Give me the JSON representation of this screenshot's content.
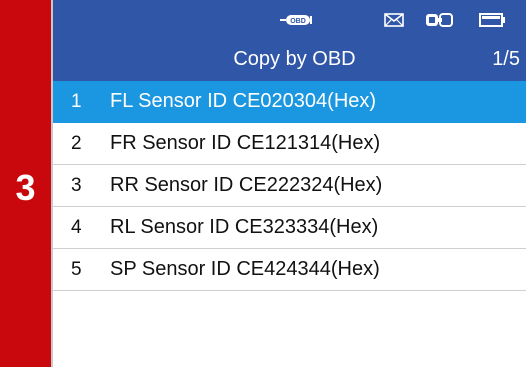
{
  "step_number": "3",
  "status_bar": {
    "obd_label": "OBD",
    "icons": [
      "obd-connector-icon",
      "mail-icon",
      "vci-connection-icon",
      "battery-icon"
    ]
  },
  "header": {
    "title": "Copy by OBD",
    "page_indicator": "1/5"
  },
  "sensor_list": [
    {
      "index": "1",
      "label": "FL Sensor ID CE020304(Hex)",
      "selected": true
    },
    {
      "index": "2",
      "label": "FR Sensor ID CE121314(Hex)",
      "selected": false
    },
    {
      "index": "3",
      "label": "RR Sensor ID CE222324(Hex)",
      "selected": false
    },
    {
      "index": "4",
      "label": "RL Sensor ID CE323334(Hex)",
      "selected": false
    },
    {
      "index": "5",
      "label": "SP Sensor ID CE424344(Hex)",
      "selected": false
    }
  ],
  "colors": {
    "step_bar": "#c8080c",
    "header": "#2f56a7",
    "selected_row": "#1b96e0"
  }
}
